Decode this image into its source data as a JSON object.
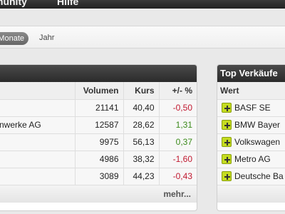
{
  "nav": {
    "items": [
      "munity",
      "Hilfe"
    ]
  },
  "period": {
    "selected": "Monate",
    "other": "Jahr"
  },
  "left_table": {
    "headers": [
      "",
      "Volumen",
      "Kurs",
      "+/- %"
    ],
    "rows": [
      {
        "name": "",
        "volumen": "21141",
        "kurs": "40,40",
        "change": "-0,50"
      },
      {
        "name": "nwerke AG",
        "volumen": "12587",
        "kurs": "28,62",
        "change": "1,31"
      },
      {
        "name": "",
        "volumen": "9975",
        "kurs": "56,13",
        "change": "0,37"
      },
      {
        "name": "",
        "volumen": "4986",
        "kurs": "38,32",
        "change": "-1,60"
      },
      {
        "name": "",
        "volumen": "3089",
        "kurs": "44,23",
        "change": "-0,43"
      }
    ],
    "more_label": "mehr..."
  },
  "right_panel": {
    "title": "Top Verkäufe",
    "header": "Wert",
    "items": [
      "BASF SE",
      "BMW Bayer",
      "Volkswagen",
      "Metro AG",
      "Deutsche Ba"
    ]
  },
  "colors": {
    "positive": "#3b8a1a",
    "negative": "#c0182f",
    "header": "#2b2b2b",
    "plus_icon": "#c5dc20"
  }
}
